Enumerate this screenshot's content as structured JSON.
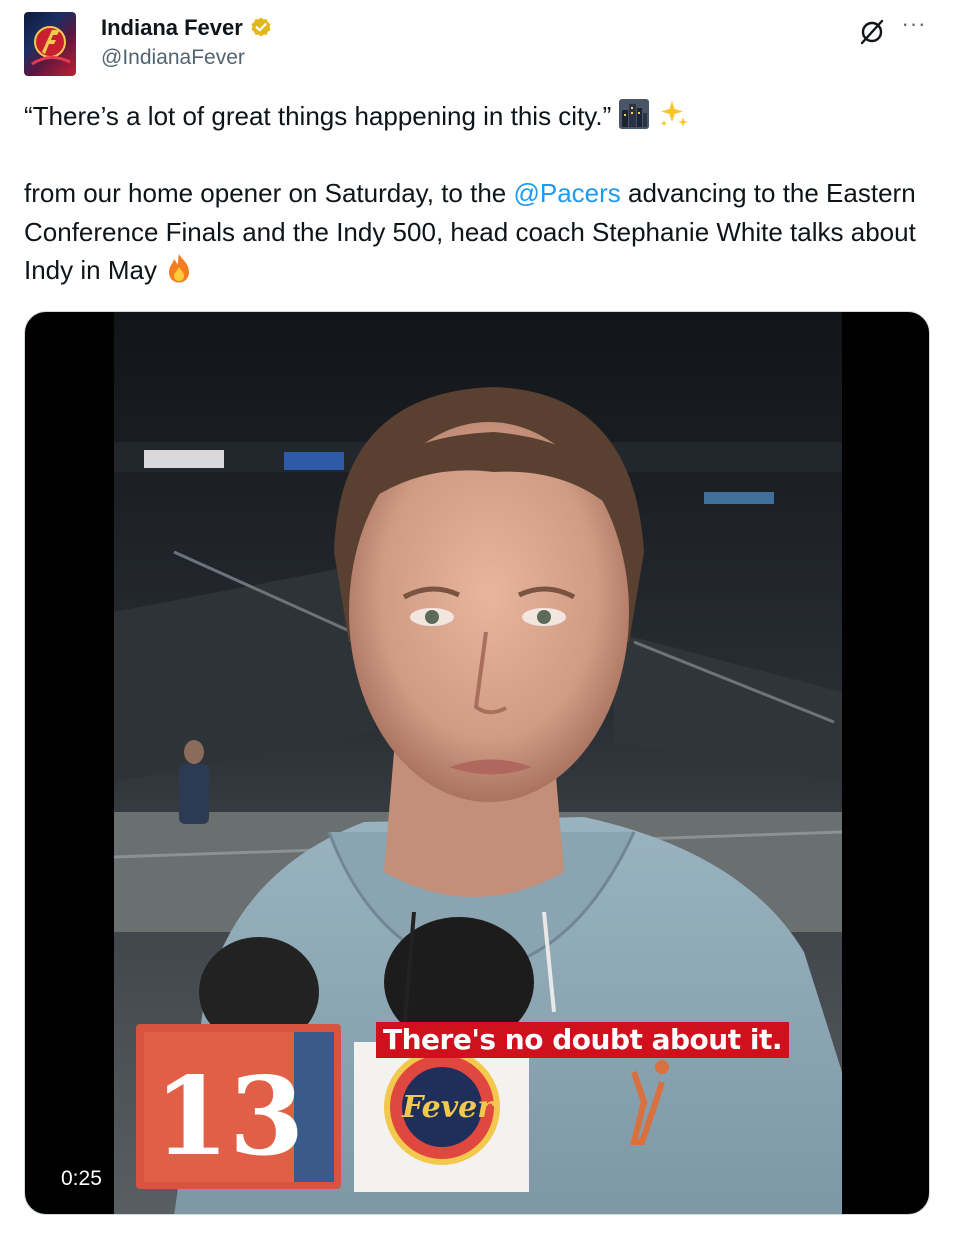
{
  "account": {
    "display_name": "Indiana Fever",
    "handle": "@IndianaFever",
    "verified": true
  },
  "header_icons": {
    "grok": "grok-icon",
    "more": "more-icon",
    "more_glyph": "···"
  },
  "tweet": {
    "line1_text": "“There’s a lot of great things happening in this city.”",
    "line1_emojis": [
      "cityscape-icon",
      "sparkles-icon"
    ],
    "body_pre": "from our home opener on Saturday, to the ",
    "mention": "@Pacers",
    "body_post": " advancing to the Eastern Conference Finals and the Indy 500, head coach Stephanie White talks about Indy in May ",
    "body_emoji": "fire-icon"
  },
  "video": {
    "caption": "There's no doubt about it.",
    "duration": "0:25",
    "mic_flag_channel": "13",
    "mic_flag_logo": "Fever"
  },
  "colors": {
    "mention": "#1d9bf0",
    "verified_badge": "#e2b719",
    "caption_bg": "#d0101c",
    "hoodie": "#8fa9b6"
  }
}
